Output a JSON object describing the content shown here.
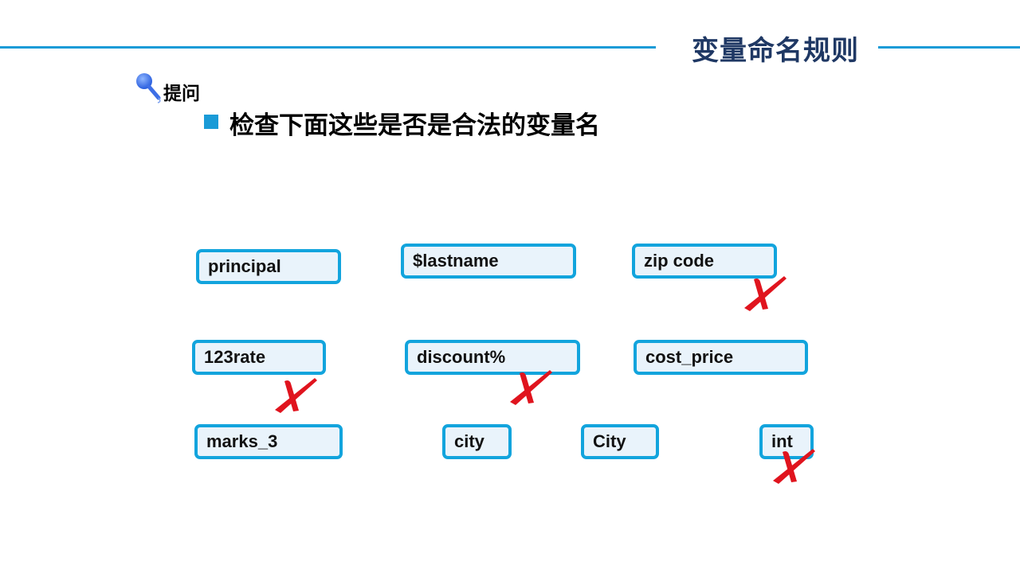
{
  "header": {
    "title": "变量命名规则"
  },
  "prompt": {
    "label": "提问",
    "question": "检查下面这些是否是合法的变量名"
  },
  "variables": [
    {
      "name": "principal",
      "invalid": false
    },
    {
      "name": "$lastname",
      "invalid": false
    },
    {
      "name": "zip code",
      "invalid": true
    },
    {
      "name": "123rate",
      "invalid": true
    },
    {
      "name": "discount%",
      "invalid": true
    },
    {
      "name": "cost_price",
      "invalid": false
    },
    {
      "name": "marks_3",
      "invalid": false
    },
    {
      "name": "city",
      "invalid": false
    },
    {
      "name": "City",
      "invalid": false
    },
    {
      "name": "int",
      "invalid": true
    }
  ],
  "colors": {
    "accent": "#1a9bd7",
    "title": "#1f3864",
    "mark": "#e0141e",
    "box_fill": "#e9f3fb"
  },
  "icons": {
    "hint": "microphone-icon",
    "invalid": "cross-mark-icon"
  }
}
